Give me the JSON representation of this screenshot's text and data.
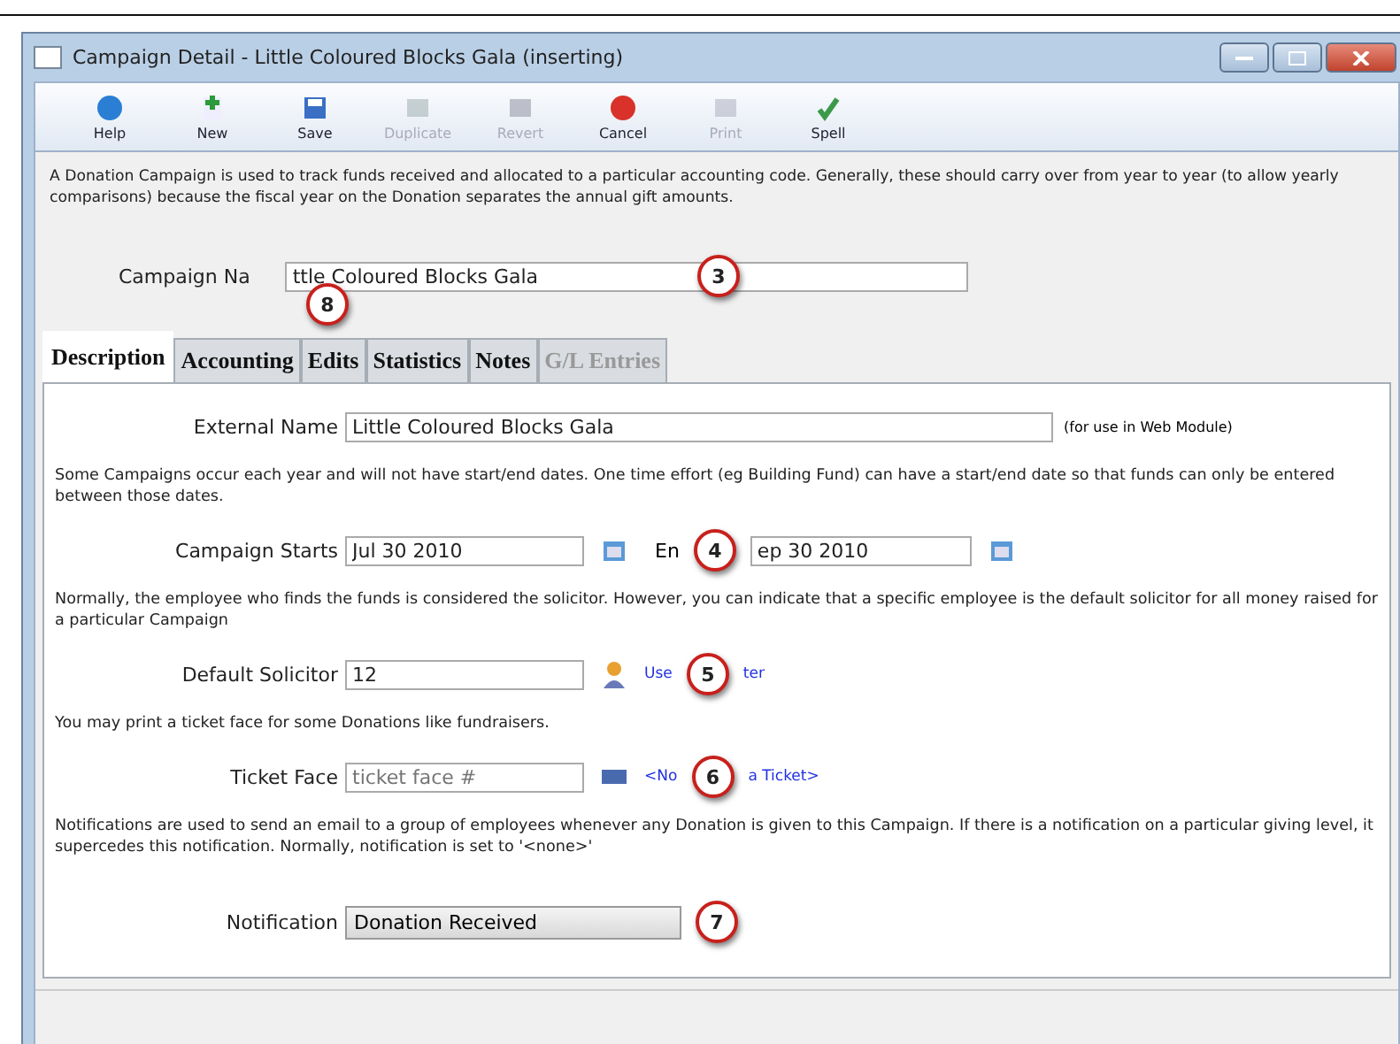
{
  "window": {
    "title": "Campaign Detail - Little Coloured Blocks Gala (inserting)"
  },
  "toolbar": [
    {
      "label": "Help",
      "kind": "help",
      "disabled": false
    },
    {
      "label": "New",
      "kind": "new",
      "disabled": false
    },
    {
      "label": "Save",
      "kind": "save",
      "disabled": false
    },
    {
      "label": "Duplicate",
      "kind": "duplicate",
      "disabled": true
    },
    {
      "label": "Revert",
      "kind": "revert",
      "disabled": true
    },
    {
      "label": "Cancel",
      "kind": "cancel",
      "disabled": false
    },
    {
      "label": "Print",
      "kind": "print",
      "disabled": true
    },
    {
      "label": "Spell",
      "kind": "spell",
      "disabled": false
    }
  ],
  "intro": "A Donation Campaign is used to track funds received and allocated to a particular accounting code.  Generally, these should carry over from year to year (to allow yearly comparisons) because the fiscal year on the Donation separates the annual gift amounts.",
  "campaign_name": {
    "label": "Campaign Na",
    "value": "ttle Coloured Blocks Gala",
    "callout": "3",
    "label_callout": "8"
  },
  "tabs": [
    {
      "label": "Description",
      "selected": true,
      "disabled": false
    },
    {
      "label": "Accounting",
      "selected": false,
      "disabled": false
    },
    {
      "label": "Edits",
      "selected": false,
      "disabled": false
    },
    {
      "label": "Statistics",
      "selected": false,
      "disabled": false
    },
    {
      "label": "Notes",
      "selected": false,
      "disabled": false
    },
    {
      "label": "G/L Entries",
      "selected": false,
      "disabled": true
    }
  ],
  "description": [
    {
      "kind": "field",
      "label": "External Name",
      "value": "Little Coloured Blocks Gala",
      "suffix": "(for use in Web Module)"
    },
    {
      "kind": "note",
      "text": "Some Campaigns occur each year and will not have start/end dates.  One time effort (eg Building Fund) can have a start/end date so that funds can only be entered between those dates."
    },
    {
      "kind": "dates",
      "label": "Campaign Starts",
      "value": "Jul 30 2010",
      "label2": "En",
      "value2": "ep 30 2010",
      "callout": "4"
    },
    {
      "kind": "note",
      "text": "Normally, the employee who finds the funds is considered the solicitor.  However, you can indicate that a specific employee is the default solicitor for all money raised for a particular Campaign"
    },
    {
      "kind": "lookup",
      "label": "Default Solicitor",
      "value": "12",
      "link": "Use",
      "link2": "ter",
      "callout": "5"
    },
    {
      "kind": "note",
      "text": "You may print a ticket face for some Donations like fundraisers."
    },
    {
      "kind": "ticket",
      "label": "Ticket Face",
      "placeholder": "ticket face #",
      "link": "<No",
      "link2": "a Ticket>",
      "callout": "6"
    },
    {
      "kind": "note",
      "text": "Notifications are used to send an email to a group of employees whenever any Donation is given to this Campaign.  If there is a notification on a particular giving level, it supercedes this notification.  Normally, notification is set to '<none>'"
    },
    {
      "kind": "select",
      "label": "Notification",
      "value": "Donation Received",
      "callout": "7"
    }
  ]
}
